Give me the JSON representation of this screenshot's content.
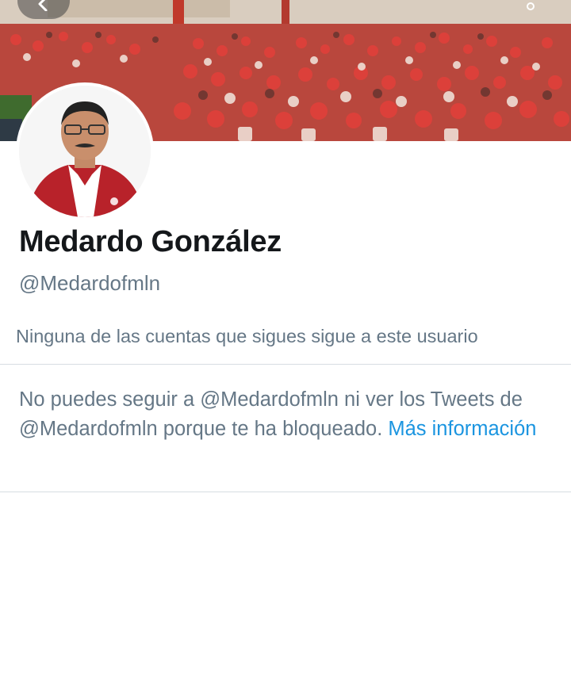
{
  "profile": {
    "display_name": "Medardo González",
    "handle": "@Medardofmln",
    "followers_note": "Ninguna de las cuentas que sigues sigue a este usuario"
  },
  "blocked_notice": {
    "text": "No puedes seguir a @Medardofmln ni ver los Tweets de @Medardofmln porque te ha bloqueado. ",
    "link_label": "Más información"
  },
  "icons": {
    "back": "arrow-left-icon",
    "more": "more-options-icon"
  },
  "colors": {
    "link": "#1b95e0",
    "secondary_text": "#657786",
    "primary_text": "#14171a",
    "banner_red": "#c8312a"
  }
}
